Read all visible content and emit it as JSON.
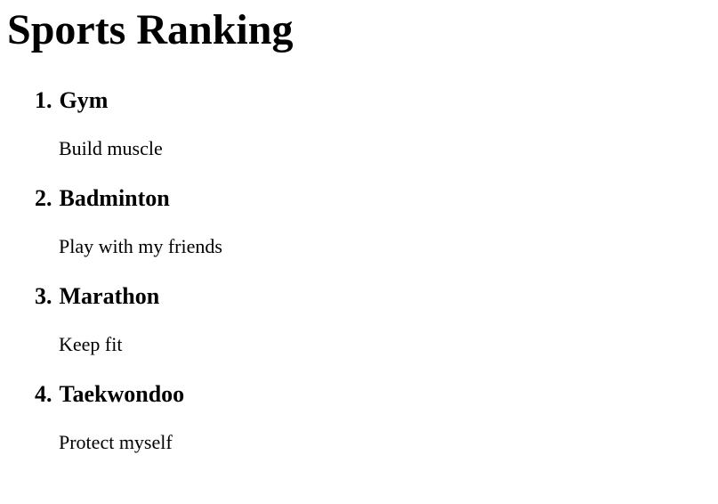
{
  "page": {
    "title": "Sports Ranking"
  },
  "ranking": {
    "items": [
      {
        "number": "1.",
        "name": "Gym",
        "description": "Build muscle"
      },
      {
        "number": "2.",
        "name": "Badminton",
        "description": "Play with my friends"
      },
      {
        "number": "3.",
        "name": "Marathon",
        "description": "Keep fit"
      },
      {
        "number": "4.",
        "name": "Taekwondoo",
        "description": "Protect myself"
      }
    ]
  }
}
